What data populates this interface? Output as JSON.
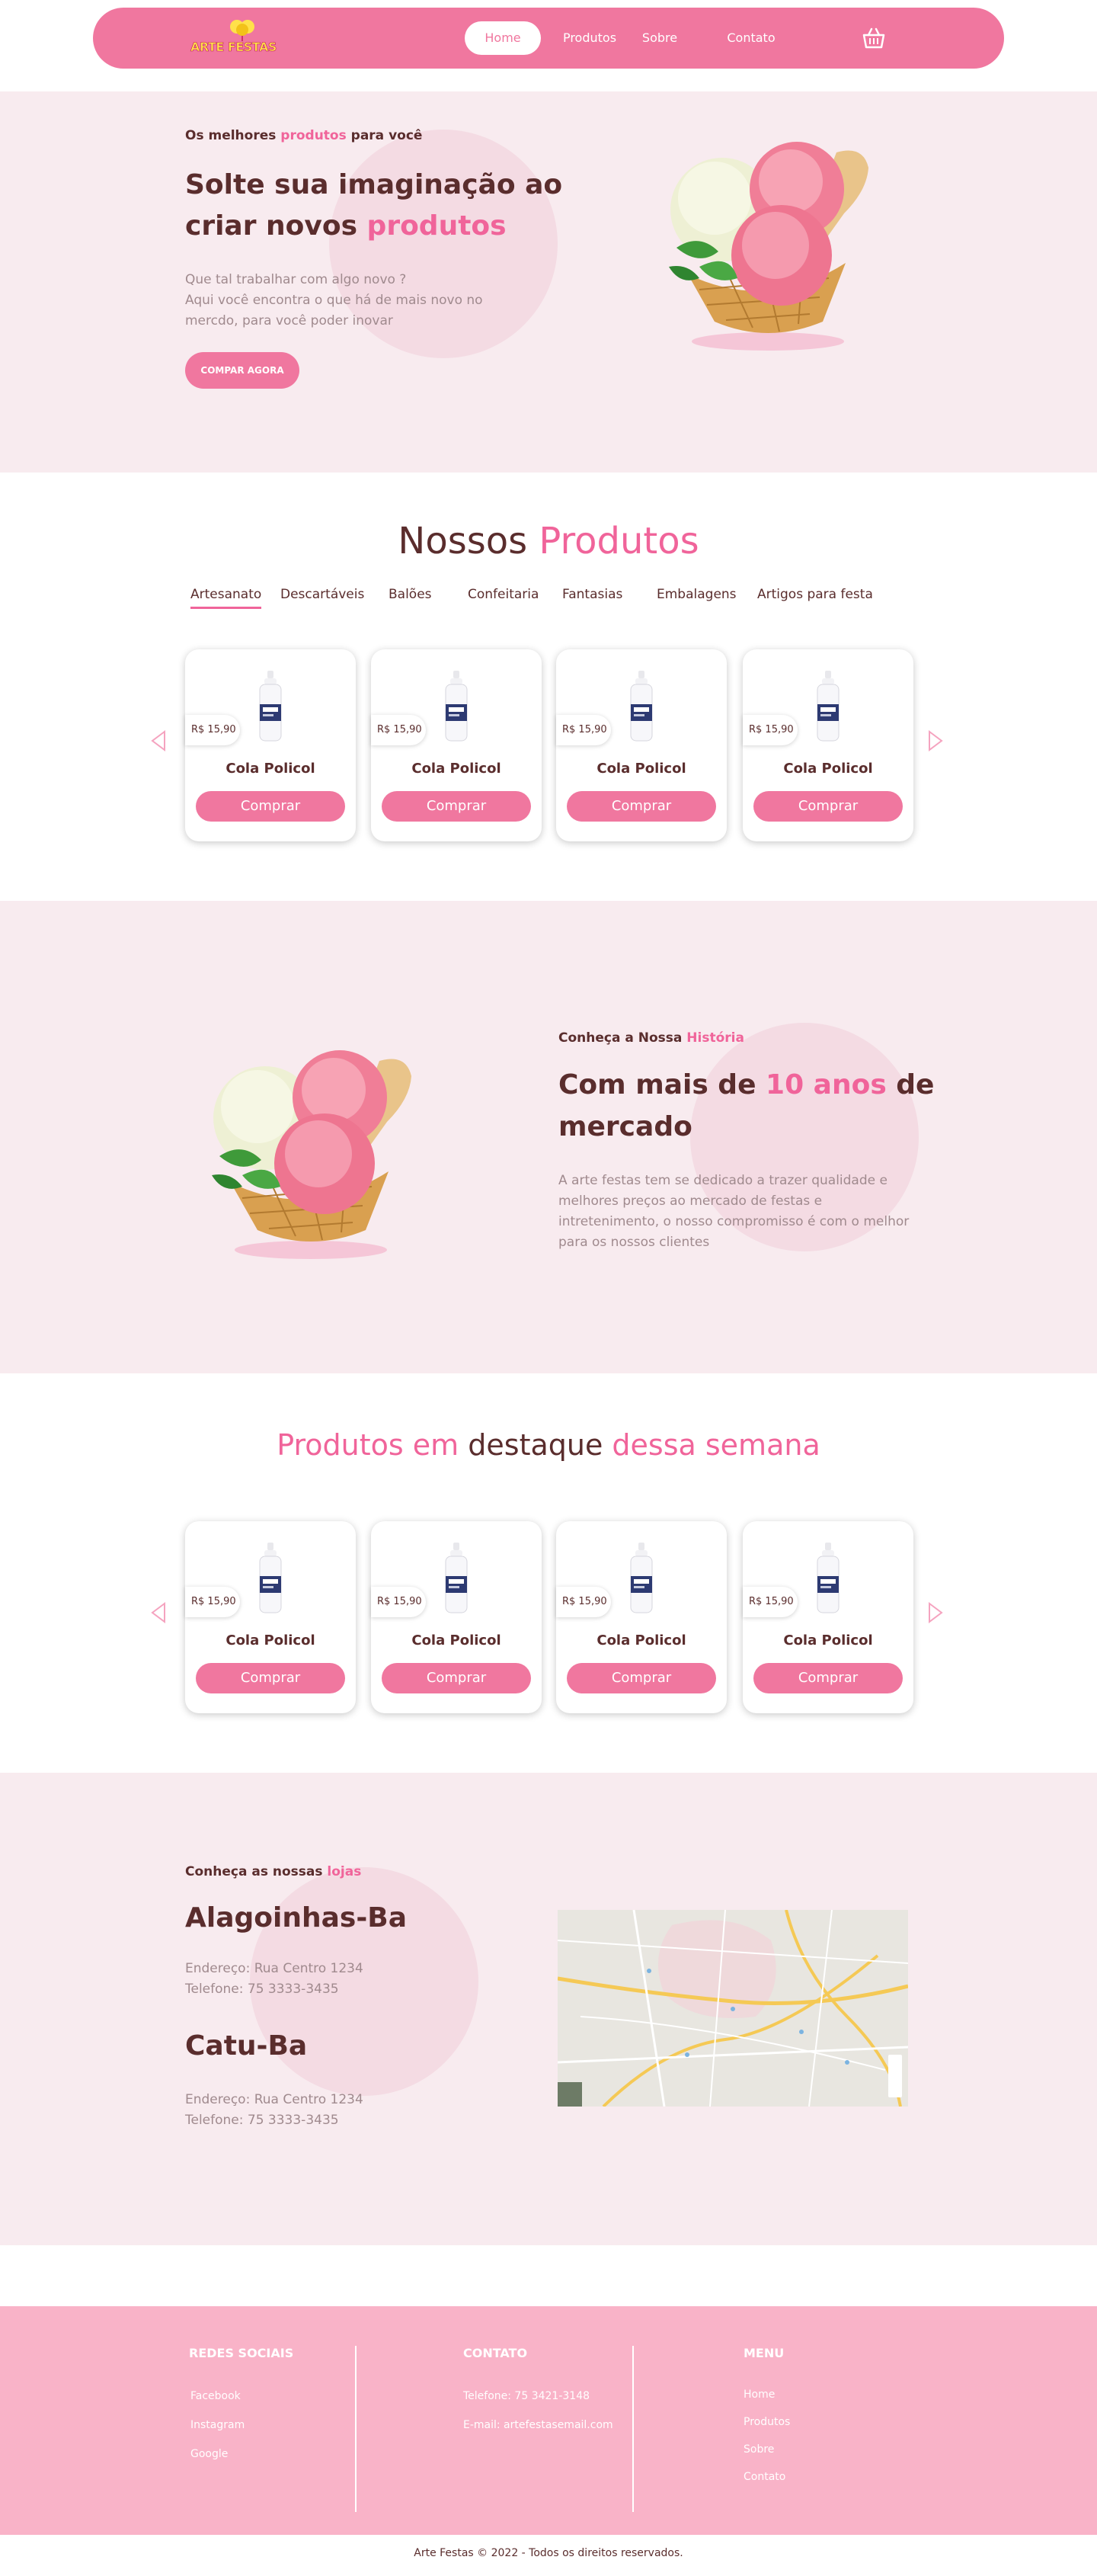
{
  "colors": {
    "primary_pink": "#f0779f",
    "accent_pink": "#f0649a",
    "section_bg": "#f8ebef",
    "footer_bg": "#f9b3c8",
    "text_brown": "#5a2d2d",
    "muted_text": "#a08a8e"
  },
  "nav": {
    "logo_text": "ARTE FESTAS",
    "links": [
      "Home",
      "Produtos",
      "Sobre",
      "Contato"
    ],
    "cart_icon": "shopping-basket-icon"
  },
  "hero": {
    "eyebrow_pre": "Os melhores ",
    "eyebrow_highlight": "produtos",
    "eyebrow_post": " para você",
    "title_pre": "Solte sua imaginação ao criar novos ",
    "title_highlight": "produtos",
    "desc_line1": "Que tal trabalhar com algo novo ?",
    "desc_line2": "Aqui você encontra o que há de mais novo no mercdo, para você poder inovar",
    "button": "COMPAR AGORA"
  },
  "products": {
    "title_pre": "Nossos ",
    "title_highlight": "Produtos",
    "tabs": [
      "Artesanato",
      "Descartáveis",
      "Balões",
      "Confeitaria",
      "Fantasias",
      "Embalagens",
      "Artigos para festa"
    ],
    "cards": [
      {
        "name": "Cola Policol",
        "price": "R$ 15,90",
        "button": "Comprar"
      },
      {
        "name": "Cola Policol",
        "price": "R$ 15,90",
        "button": "Comprar"
      },
      {
        "name": "Cola Policol",
        "price": "R$ 15,90",
        "button": "Comprar"
      },
      {
        "name": "Cola Policol",
        "price": "R$ 15,90",
        "button": "Comprar"
      }
    ]
  },
  "history": {
    "eyebrow_pre": "Conheça a Nossa ",
    "eyebrow_highlight": "História",
    "title_pre": "Com mais de ",
    "title_highlight": "10 anos",
    "title_post": " de mercado",
    "desc": "A arte festas tem se dedicado a trazer qualidade e melhores preços ao mercado de festas e intretenimento, o nosso compromisso é com o melhor para os nossos clientes"
  },
  "featured": {
    "title_part1": "Produtos em ",
    "title_part2": "destaque",
    "title_part3": " dessa semana",
    "cards": [
      {
        "name": "Cola Policol",
        "price": "R$ 15,90",
        "button": "Comprar"
      },
      {
        "name": "Cola Policol",
        "price": "R$ 15,90",
        "button": "Comprar"
      },
      {
        "name": "Cola Policol",
        "price": "R$ 15,90",
        "button": "Comprar"
      },
      {
        "name": "Cola Policol",
        "price": "R$ 15,90",
        "button": "Comprar"
      }
    ]
  },
  "stores": {
    "eyebrow_pre": "Conheça as nossas ",
    "eyebrow_highlight": "lojas",
    "list": [
      {
        "name": "Alagoinhas-Ba",
        "address": "Endereço: Rua Centro 1234",
        "phone": "Telefone: 75 3333-3435"
      },
      {
        "name": "Catu-Ba",
        "address": "Endereço: Rua Centro 1234",
        "phone": "Telefone: 75 3333-3435"
      }
    ]
  },
  "footer": {
    "social": {
      "heading": "REDES SOCIAIS",
      "items": [
        "Facebook",
        "Instagram",
        "Google"
      ]
    },
    "contact": {
      "heading": "CONTATO",
      "items": [
        "Telefone: 75 3421-3148",
        "E-mail: artefestasemail.com"
      ]
    },
    "menu": {
      "heading": "MENU",
      "items": [
        "Home",
        "Produtos",
        "Sobre",
        "Contato"
      ]
    },
    "copyright": "Arte Festas © 2022 - Todos os direitos reservados."
  }
}
